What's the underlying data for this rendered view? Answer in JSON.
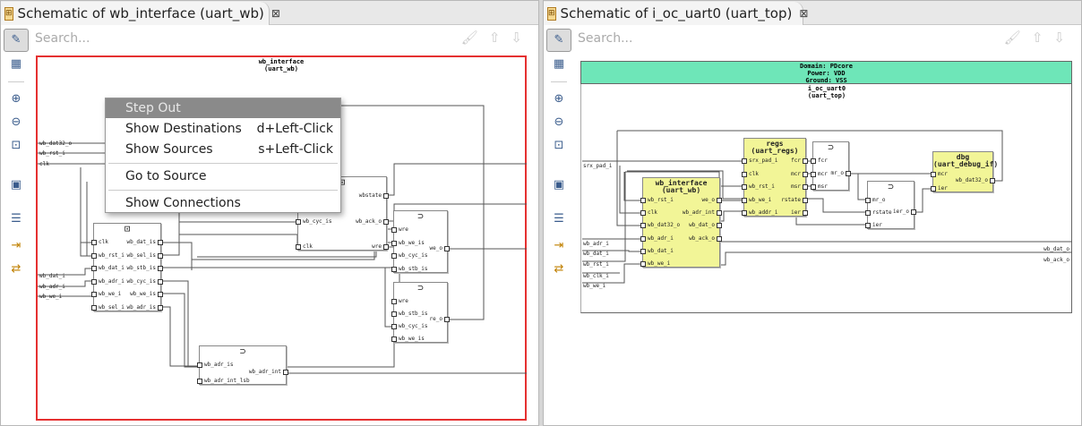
{
  "left_panel": {
    "tab_title": "Schematic of wb_interface (uart_wb)",
    "search_placeholder": "Search...",
    "module_title": "wb_interface",
    "module_subtitle": "(uart_wb)",
    "inputs": [
      "wb_dat32_o",
      "wb_rst_i",
      "clk",
      "wb_dat_i",
      "wb_adr_i",
      "wb_we_i"
    ],
    "outputs": [
      "wb_dat_o",
      "wb_ack_o",
      "we_o",
      "wb_adr_int"
    ],
    "blocks": [
      {
        "id": "a",
        "symbol": "flip-flop",
        "left": [
          "clk",
          "wb_rst_i",
          "wb_dat_i",
          "wb_adr_i",
          "wb_we_i",
          "wb_sel_i"
        ],
        "right": [
          "wb_dat_is",
          "wb_sel_is",
          "wb_stb_is",
          "wb_cyc_is",
          "wb_we_is",
          "wb_adr_is"
        ]
      },
      {
        "id": "b",
        "symbol": "flip-flop",
        "left": [
          "wb_rst_i",
          "wb_cyc_is",
          "clk"
        ],
        "right": [
          "wbstate",
          "wb_ack_o",
          "wre"
        ]
      },
      {
        "id": "c",
        "symbol": "gate",
        "left": [
          "wre",
          "wb_we_is",
          "wb_cyc_is",
          "wb_stb_is"
        ],
        "right": [
          "we_o"
        ]
      },
      {
        "id": "d",
        "symbol": "gate",
        "left": [
          "wre",
          "wb_stb_is",
          "wb_cyc_is",
          "wb_we_is"
        ],
        "right": [
          "re_o"
        ]
      },
      {
        "id": "e",
        "symbol": "gate",
        "left": [
          "wb_adr_is",
          "wb_adr_int_lsb"
        ],
        "right": [
          "wb_adr_int"
        ]
      }
    ],
    "context_menu": {
      "items": [
        {
          "label": "Step Out",
          "shortcut": "",
          "highlighted": true
        },
        {
          "label": "Show Destinations",
          "shortcut": "d+Left-Click"
        },
        {
          "label": "Show Sources",
          "shortcut": "s+Left-Click"
        },
        {
          "label": "Go to Source",
          "shortcut": ""
        },
        {
          "label": "Show Connections",
          "shortcut": ""
        }
      ]
    }
  },
  "right_panel": {
    "tab_title": "Schematic of i_oc_uart0 (uart_top)",
    "search_placeholder": "Search...",
    "domain": [
      "Domain: PDcore",
      "Power: VDD",
      "Ground: VSS"
    ],
    "module_title": "i_oc_uart0",
    "module_subtitle": "(uart_top)",
    "inputs": [
      "srx_pad_i",
      "wb_adr_i",
      "wb_dat_i",
      "wb_rst_i",
      "wb_clk_i",
      "wb_we_i"
    ],
    "outputs": [
      "wb_dat_o",
      "wb_ack_o"
    ],
    "blocks": [
      {
        "id": "regs",
        "title": "regs",
        "subtitle": "(uart_regs)",
        "left": [
          "srx_pad_i",
          "clk",
          "wb_rst_i",
          "wb_we_i",
          "wb_addr_i"
        ],
        "right": [
          "fcr",
          "mcr",
          "msr",
          "rstate",
          "ier"
        ]
      },
      {
        "id": "wbi",
        "title": "wb_interface",
        "subtitle": "(uart_wb)",
        "left": [
          "wb_rst_i",
          "clk",
          "wb_dat32_o",
          "wb_adr_i",
          "wb_dat_i",
          "wb_we_i"
        ],
        "right": [
          "we_o",
          "wb_adr_int",
          "wb_dat_o",
          "wb_ack_o"
        ]
      },
      {
        "id": "g1",
        "symbol": "gate",
        "left": [
          "fcr",
          "mcr",
          "msr"
        ],
        "right": [
          "mr_o"
        ]
      },
      {
        "id": "g2",
        "symbol": "gate",
        "left": [
          "mr_o",
          "rstate",
          "ier"
        ],
        "right": [
          "ier_o"
        ]
      },
      {
        "id": "dbg",
        "title": "dbg",
        "subtitle": "(uart_debug_if)",
        "left": [
          "mcr",
          "ier"
        ],
        "right": [
          "wb_dat32_o"
        ]
      }
    ]
  },
  "colors": {
    "module_border": "#e53030",
    "highlight_block": "#f2f597",
    "domain_header": "#6ee6b8"
  }
}
